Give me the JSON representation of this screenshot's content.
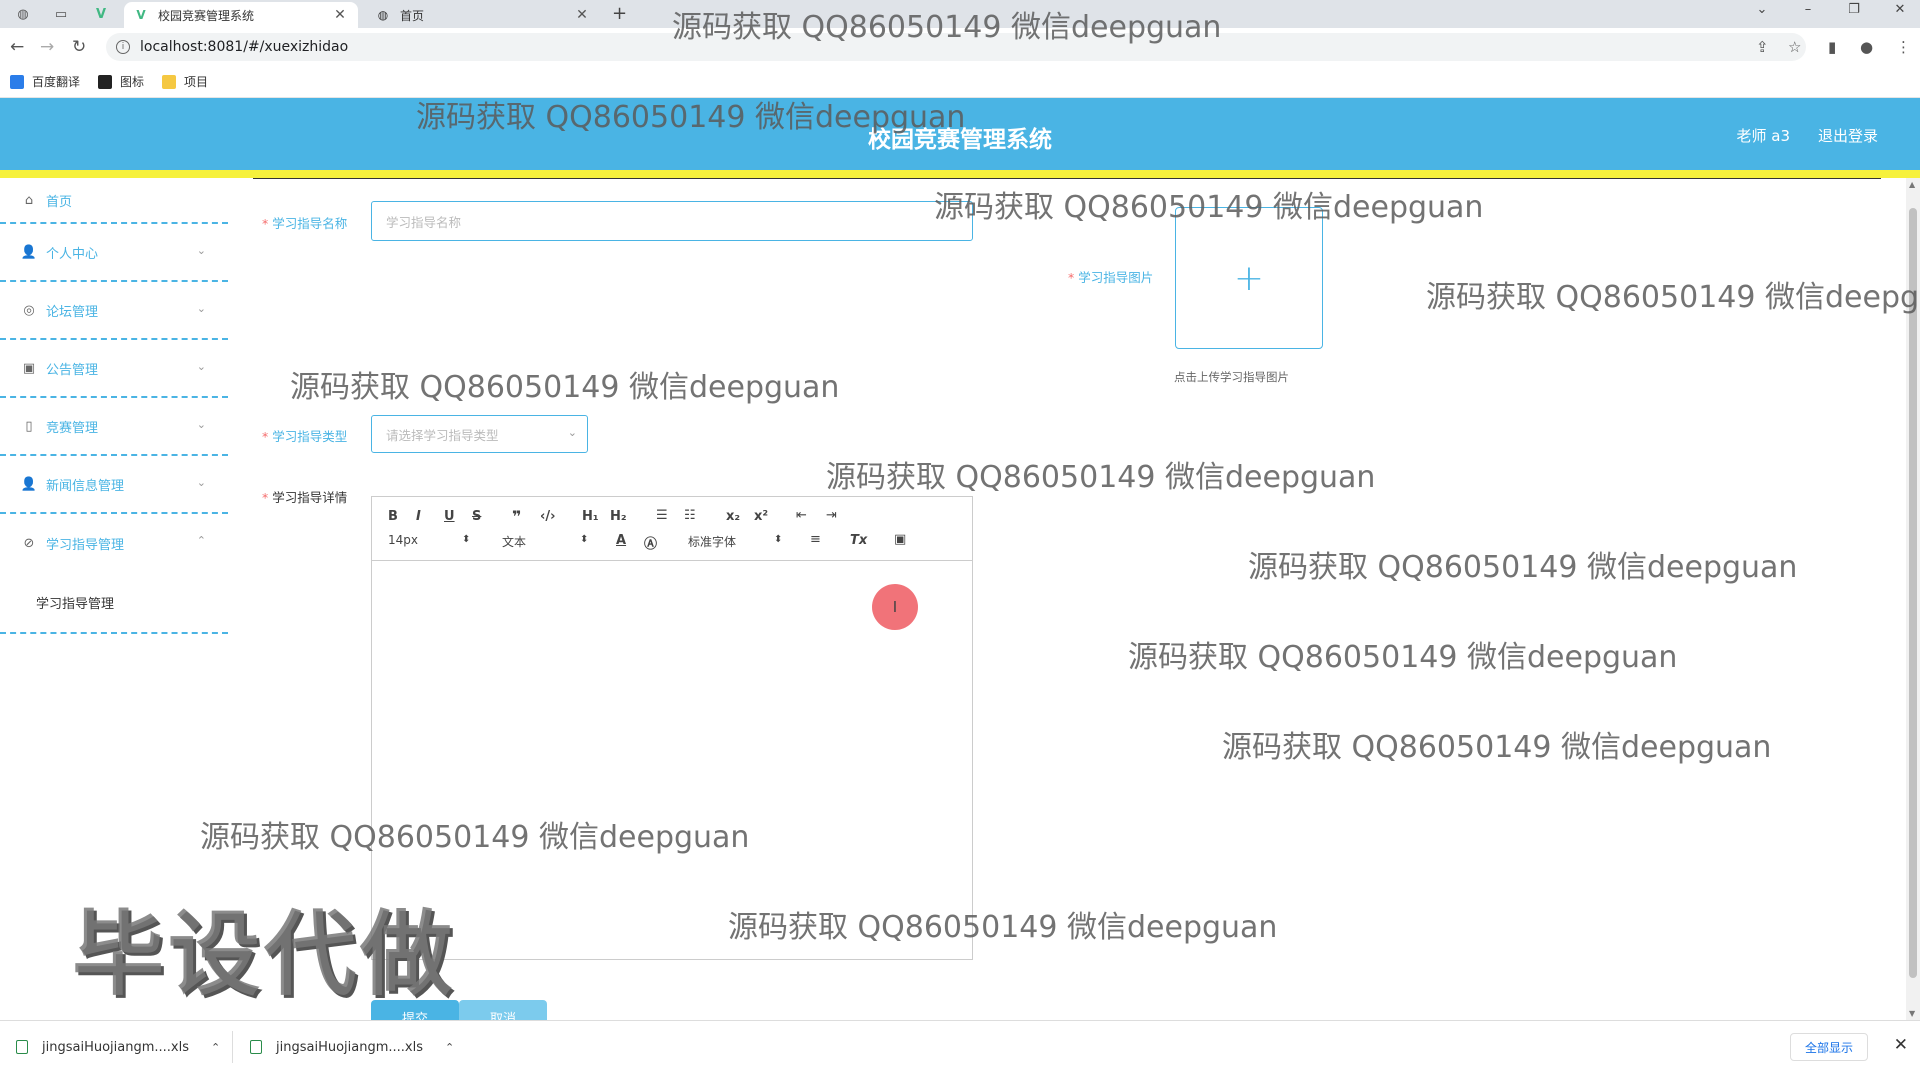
{
  "browser": {
    "tabs": [
      {
        "title": "校园竞赛管理系统",
        "active": true
      },
      {
        "title": "首页",
        "active": false
      }
    ],
    "url": "localhost:8081/#/xuexizhidao",
    "bookmarks": [
      "百度翻译",
      "图标",
      "项目"
    ]
  },
  "header": {
    "title": "校园竞赛管理系统",
    "user": "老师 a3",
    "logout": "退出登录",
    "color": "#4ab4e4",
    "accent": "#f6f13c"
  },
  "sidebar": {
    "items": [
      {
        "label": "首页",
        "icon": "home-icon"
      },
      {
        "label": "个人中心",
        "icon": "user-icon"
      },
      {
        "label": "论坛管理",
        "icon": "forum-icon"
      },
      {
        "label": "公告管理",
        "icon": "notice-icon"
      },
      {
        "label": "竞赛管理",
        "icon": "contest-icon"
      },
      {
        "label": "新闻信息管理",
        "icon": "news-icon"
      },
      {
        "label": "学习指导管理",
        "icon": "study-icon"
      }
    ],
    "submenu": "学习指导管理"
  },
  "form": {
    "name_label": "学习指导名称",
    "name_placeholder": "学习指导名称",
    "image_label": "学习指导图片",
    "image_tip": "点击上传学习指导图片",
    "type_label": "学习指导类型",
    "type_placeholder": "请选择学习指导类型",
    "detail_label": "学习指导详情",
    "submit": "提交",
    "cancel": "取消"
  },
  "editor": {
    "font_size": "14px",
    "heading": "文本",
    "font_family": "标准字体"
  },
  "downloads": {
    "items": [
      "jingsaiHuojiangm....xls",
      "jingsaiHuojiangm....xls"
    ],
    "show_all": "全部显示"
  },
  "watermark": {
    "text": "源码获取 QQ86050149 微信deepguan",
    "big": "毕设代做"
  }
}
